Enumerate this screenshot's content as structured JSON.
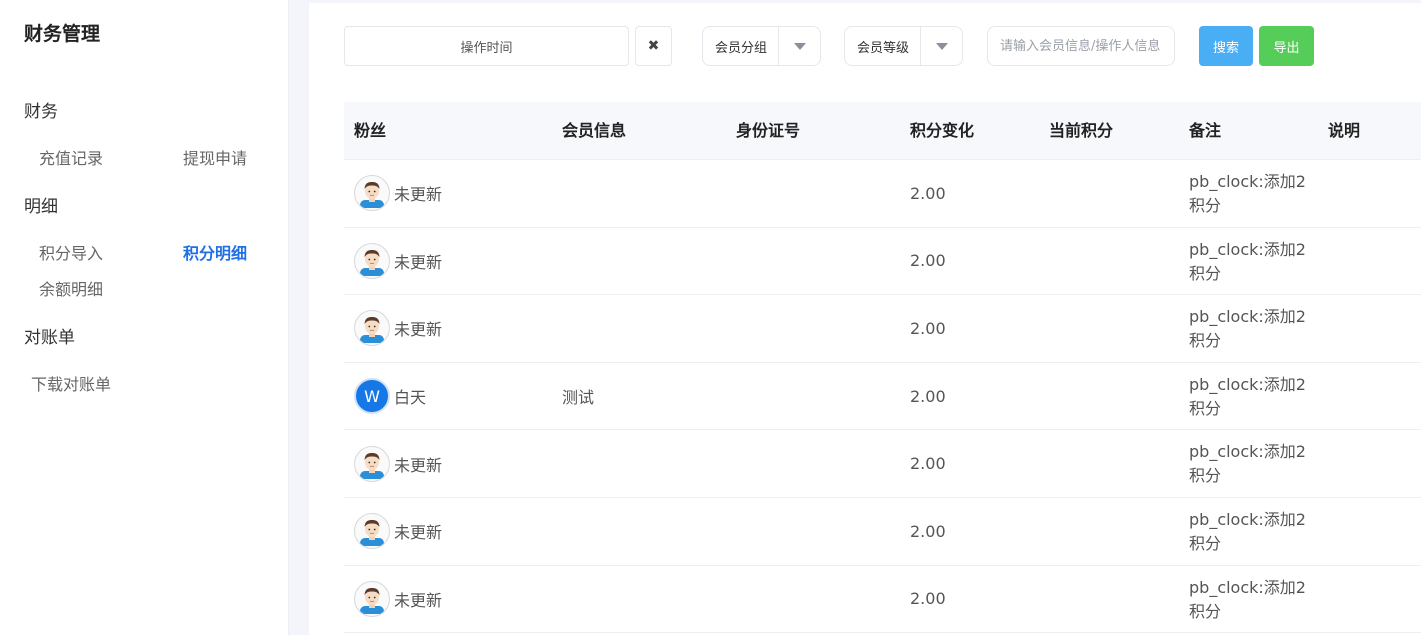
{
  "sidebar": {
    "title": "财务管理",
    "groups": [
      {
        "label": "财务",
        "items": [
          "充值记录",
          "提现申请"
        ]
      },
      {
        "label": "明细",
        "items": [
          "积分导入",
          "积分明细",
          "余额明细"
        ]
      },
      {
        "label": "对账单",
        "items": [
          "下载对账单"
        ]
      }
    ],
    "active_item": "积分明细"
  },
  "filters": {
    "date_placeholder": "操作时间",
    "clear_icon": "✖",
    "member_group": "会员分组",
    "member_level": "会员等级",
    "search_placeholder": "请输入会员信息/操作人信息",
    "search_button": "搜索",
    "export_button": "导出"
  },
  "table": {
    "columns": [
      "粉丝",
      "会员信息",
      "身份证号",
      "积分变化",
      "当前积分",
      "备注",
      "说明"
    ],
    "rows": [
      {
        "avatar": "default-avatar",
        "fan": "未更新",
        "member": "",
        "id_card": "",
        "change": "2.00",
        "current": "",
        "note": "pb_clock:添加2积分",
        "desc": ""
      },
      {
        "avatar": "default-avatar",
        "fan": "未更新",
        "member": "",
        "id_card": "",
        "change": "2.00",
        "current": "",
        "note": "pb_clock:添加2积分",
        "desc": ""
      },
      {
        "avatar": "default-avatar",
        "fan": "未更新",
        "member": "",
        "id_card": "",
        "change": "2.00",
        "current": "",
        "note": "pb_clock:添加2积分",
        "desc": ""
      },
      {
        "avatar": "W",
        "fan": "白天",
        "member": "测试",
        "id_card": "",
        "change": "2.00",
        "current": "",
        "note": "pb_clock:添加2积分",
        "desc": ""
      },
      {
        "avatar": "default-avatar",
        "fan": "未更新",
        "member": "",
        "id_card": "",
        "change": "2.00",
        "current": "",
        "note": "pb_clock:添加2积分",
        "desc": ""
      },
      {
        "avatar": "default-avatar",
        "fan": "未更新",
        "member": "",
        "id_card": "",
        "change": "2.00",
        "current": "",
        "note": "pb_clock:添加2积分",
        "desc": ""
      },
      {
        "avatar": "default-avatar",
        "fan": "未更新",
        "member": "",
        "id_card": "",
        "change": "2.00",
        "current": "",
        "note": "pb_clock:添加2积分",
        "desc": ""
      }
    ]
  },
  "colors": {
    "accent": "#1f6fe5",
    "search_button": "#4aaef5",
    "export_button": "#56cc59",
    "avatar_w": "#1677e6"
  }
}
